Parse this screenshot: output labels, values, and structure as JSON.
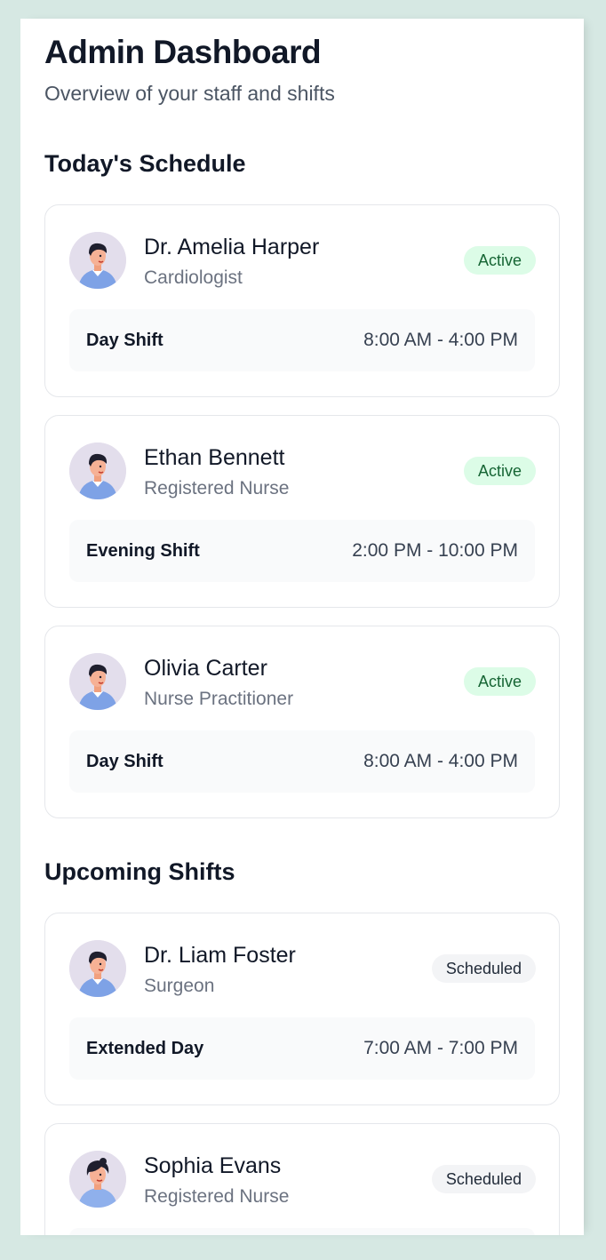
{
  "header": {
    "title": "Admin Dashboard",
    "subtitle": "Overview of your staff and shifts"
  },
  "sections": {
    "today": {
      "title": "Today's Schedule",
      "cards": [
        {
          "name": "Dr. Amelia Harper",
          "role": "Cardiologist",
          "status": "Active",
          "shift_name": "Day Shift",
          "shift_time": "8:00 AM - 4:00 PM",
          "avatar": "avatar-male-icon"
        },
        {
          "name": "Ethan Bennett",
          "role": "Registered Nurse",
          "status": "Active",
          "shift_name": "Evening Shift",
          "shift_time": "2:00 PM - 10:00 PM",
          "avatar": "avatar-male-icon"
        },
        {
          "name": "Olivia Carter",
          "role": "Nurse Practitioner",
          "status": "Active",
          "shift_name": "Day Shift",
          "shift_time": "8:00 AM - 4:00 PM",
          "avatar": "avatar-male-icon"
        }
      ]
    },
    "upcoming": {
      "title": "Upcoming Shifts",
      "cards": [
        {
          "name": "Dr. Liam Foster",
          "role": "Surgeon",
          "status": "Scheduled",
          "shift_name": "Extended Day",
          "shift_time": "7:00 AM - 7:00 PM",
          "avatar": "avatar-male-icon"
        },
        {
          "name": "Sophia Evans",
          "role": "Registered Nurse",
          "status": "Scheduled",
          "shift_name": "",
          "shift_time": "",
          "avatar": "avatar-female-icon"
        }
      ]
    }
  },
  "colors": {
    "page_background": "#d6e8e3",
    "active_badge_bg": "#dcfce7",
    "active_badge_text": "#166534",
    "scheduled_badge_bg": "#f3f4f6",
    "avatar_bg": "#e3deec"
  }
}
